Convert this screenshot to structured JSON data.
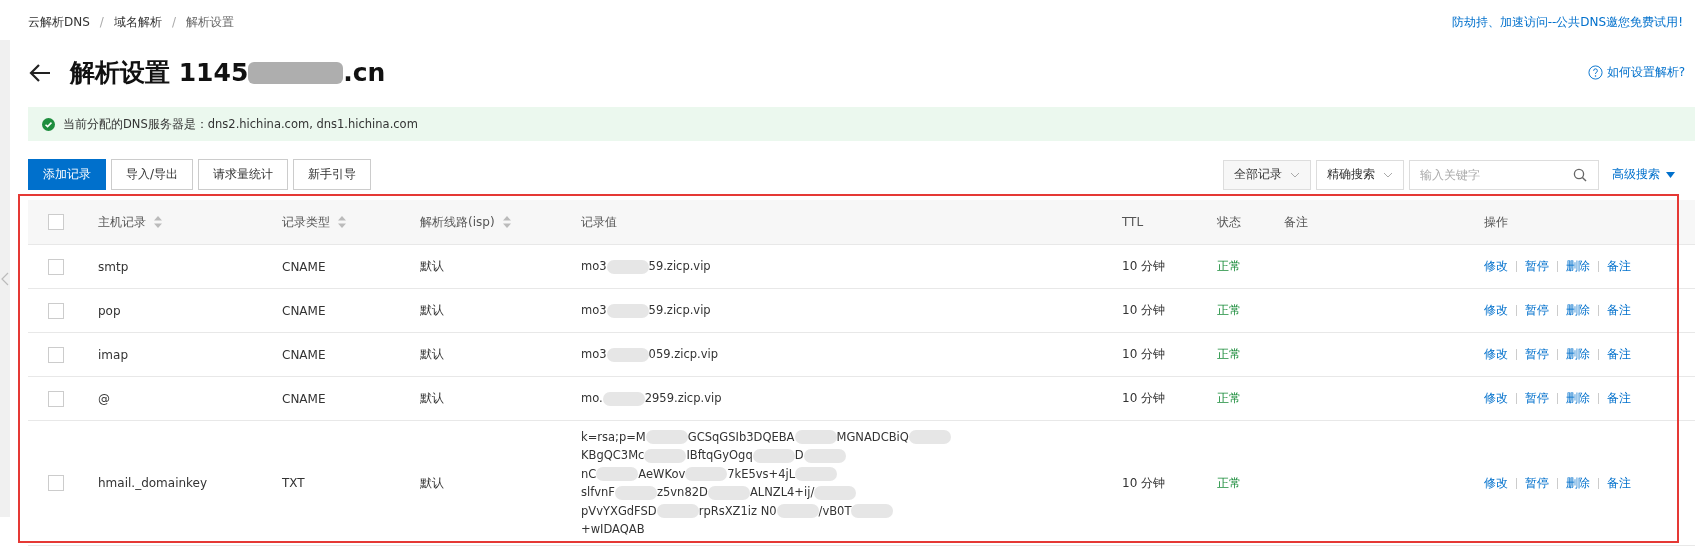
{
  "breadcrumb": [
    {
      "label": "云解析DNS"
    },
    {
      "label": "域名解析"
    },
    {
      "label": "解析设置"
    }
  ],
  "separator": "/",
  "promo_link": "防劫持、加速访问--公共DNS邀您免费试用!",
  "title": {
    "prefix": "解析设置 1145",
    "suffix": ".cn"
  },
  "help_link": "如何设置解析?",
  "notice": "当前分配的DNS服务器是：dns2.hichina.com, dns1.hichina.com",
  "toolbar": {
    "buttons": [
      {
        "label": "添加记录",
        "primary": true
      },
      {
        "label": "导入/导出",
        "primary": false
      },
      {
        "label": "请求量统计",
        "primary": false
      },
      {
        "label": "新手引导",
        "primary": false
      }
    ],
    "filter": "全部记录",
    "search_mode": "精确搜索",
    "search": {
      "placeholder": "输入关键字"
    },
    "advanced": "高级搜索"
  },
  "table": {
    "select_all_checked": false,
    "columns": [
      {
        "label": "主机记录",
        "sortable": true
      },
      {
        "label": "记录类型",
        "sortable": true
      },
      {
        "label": "解析线路(isp)",
        "sortable": true
      },
      {
        "label": "记录值",
        "sortable": false
      },
      {
        "label": "TTL",
        "sortable": false
      },
      {
        "label": "状态",
        "sortable": false
      },
      {
        "label": "备注",
        "sortable": false
      },
      {
        "label": "操作",
        "sortable": false
      }
    ],
    "rows": [
      {
        "checked": false,
        "host": "smtp",
        "type": "CNAME",
        "line": "默认",
        "value_lines": [
          [
            "mo3",
            "59.zicp.vip"
          ]
        ],
        "ttl": "10 分钟",
        "status": "正常",
        "actions": [
          "修改",
          "暂停",
          "删除",
          "备注"
        ]
      },
      {
        "checked": false,
        "host": "pop",
        "type": "CNAME",
        "line": "默认",
        "value_lines": [
          [
            "mo3",
            "59.zicp.vip"
          ]
        ],
        "ttl": "10 分钟",
        "status": "正常",
        "actions": [
          "修改",
          "暂停",
          "删除",
          "备注"
        ]
      },
      {
        "checked": false,
        "host": "imap",
        "type": "CNAME",
        "line": "默认",
        "value_lines": [
          [
            "mo3",
            "059.zicp.vip"
          ]
        ],
        "ttl": "10 分钟",
        "status": "正常",
        "actions": [
          "修改",
          "暂停",
          "删除",
          "备注"
        ]
      },
      {
        "checked": false,
        "host": "@",
        "type": "CNAME",
        "line": "默认",
        "value_lines": [
          [
            "mo.",
            "2959.zicp.vip"
          ]
        ],
        "ttl": "10 分钟",
        "status": "正常",
        "actions": [
          "修改",
          "暂停",
          "删除",
          "备注"
        ]
      },
      {
        "checked": false,
        "host": "hmail._domainkey",
        "type": "TXT",
        "line": "默认",
        "value_lines": [
          [
            "k=rsa;p=M",
            "GCSqGSIb3DQEBA",
            "MGNADCBiQ"
          ],
          [
            "KBgQC3Mc",
            "IBftqGyOgq",
            "D"
          ],
          [
            "nC",
            "AeWKov",
            "7kE5vs+4jL"
          ],
          [
            "slfvnF",
            "z5vn82D",
            "ALNZL4+ij/"
          ],
          [
            "pVvYXGdFSD",
            "rpRsXZ1iz N0",
            "/vB0T"
          ],
          [
            "+wIDAQAB"
          ]
        ],
        "ttl": "10 分钟",
        "status": "正常",
        "actions": [
          "修改",
          "暂停",
          "删除",
          "备注"
        ]
      }
    ]
  }
}
